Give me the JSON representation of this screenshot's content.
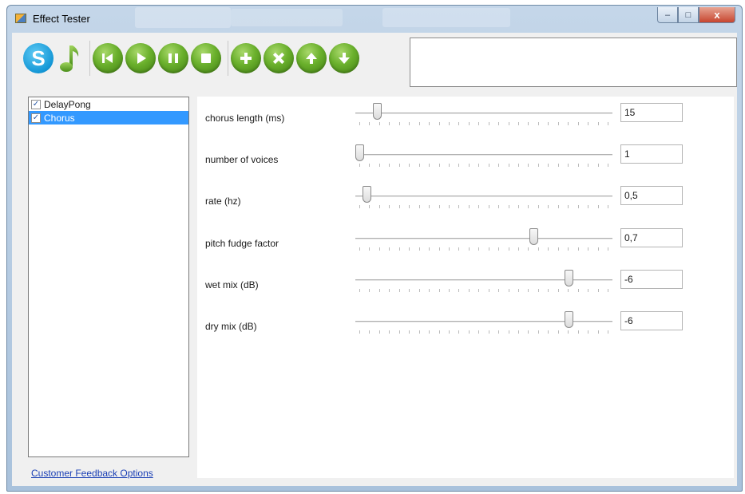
{
  "window": {
    "title": "Effect Tester",
    "close_glyph": "x",
    "minimize_glyph": "–",
    "maximize_glyph": "□"
  },
  "toolbar": {
    "buttons": [
      {
        "name": "skype-icon",
        "glyph": "S"
      },
      {
        "name": "music-note-icon"
      },
      {
        "name": "previous-icon"
      },
      {
        "name": "play-icon"
      },
      {
        "name": "pause-icon"
      },
      {
        "name": "stop-icon"
      },
      {
        "name": "add-icon"
      },
      {
        "name": "remove-icon"
      },
      {
        "name": "move-up-icon"
      },
      {
        "name": "move-down-icon"
      }
    ],
    "field_value": ""
  },
  "effects": [
    {
      "label": "DelayPong",
      "checked": true,
      "selected": false
    },
    {
      "label": "Chorus",
      "checked": true,
      "selected": true
    }
  ],
  "check_glyph": "✓",
  "feedback_link": "Customer Feedback Options",
  "params": [
    {
      "label": "chorus length (ms)",
      "value": "15",
      "position": 0.07
    },
    {
      "label": "number of voices",
      "value": "1",
      "position": 0.0
    },
    {
      "label": "rate (hz)",
      "value": "0,5",
      "position": 0.03
    },
    {
      "label": "pitch fudge factor",
      "value": "0,7",
      "position": 0.7
    },
    {
      "label": "wet mix (dB)",
      "value": "-6",
      "position": 0.84
    },
    {
      "label": "dry mix (dB)",
      "value": "-6",
      "position": 0.84
    }
  ],
  "colors": {
    "accent_green": "#6ab02c",
    "skype_blue": "#1497d6",
    "selection": "#3399ff",
    "link": "#1a3fb5"
  }
}
